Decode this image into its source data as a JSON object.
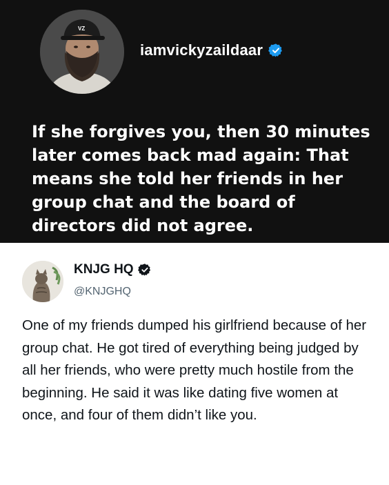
{
  "top_post": {
    "avatar_icon": "profile-photo-bearded-man-cap",
    "cap_text": "VZ",
    "username": "iamvickyzaildaar",
    "verified_icon": "verified-badge-blue",
    "text": "If she forgives you, then 30 minutes later comes back mad again: That means she told her friends in her group chat and the board of directors did not agree."
  },
  "tweet": {
    "avatar_icon": "profile-photo-cat",
    "display_name": "KNJG HQ",
    "verified_icon": "verified-badge-dark",
    "handle": "@KNJGHQ",
    "text": "One of my friends dumped his girlfriend because of her group chat. He got tired of everything being judged by all her friends, who were pretty much hostile from the beginning. He said it was like dating five women at once, and four of them didn’t like you."
  },
  "colors": {
    "top_background": "#111111",
    "verified_blue": "#1d9bf0",
    "tweet_text": "#0f1419",
    "handle_gray": "#536471"
  }
}
